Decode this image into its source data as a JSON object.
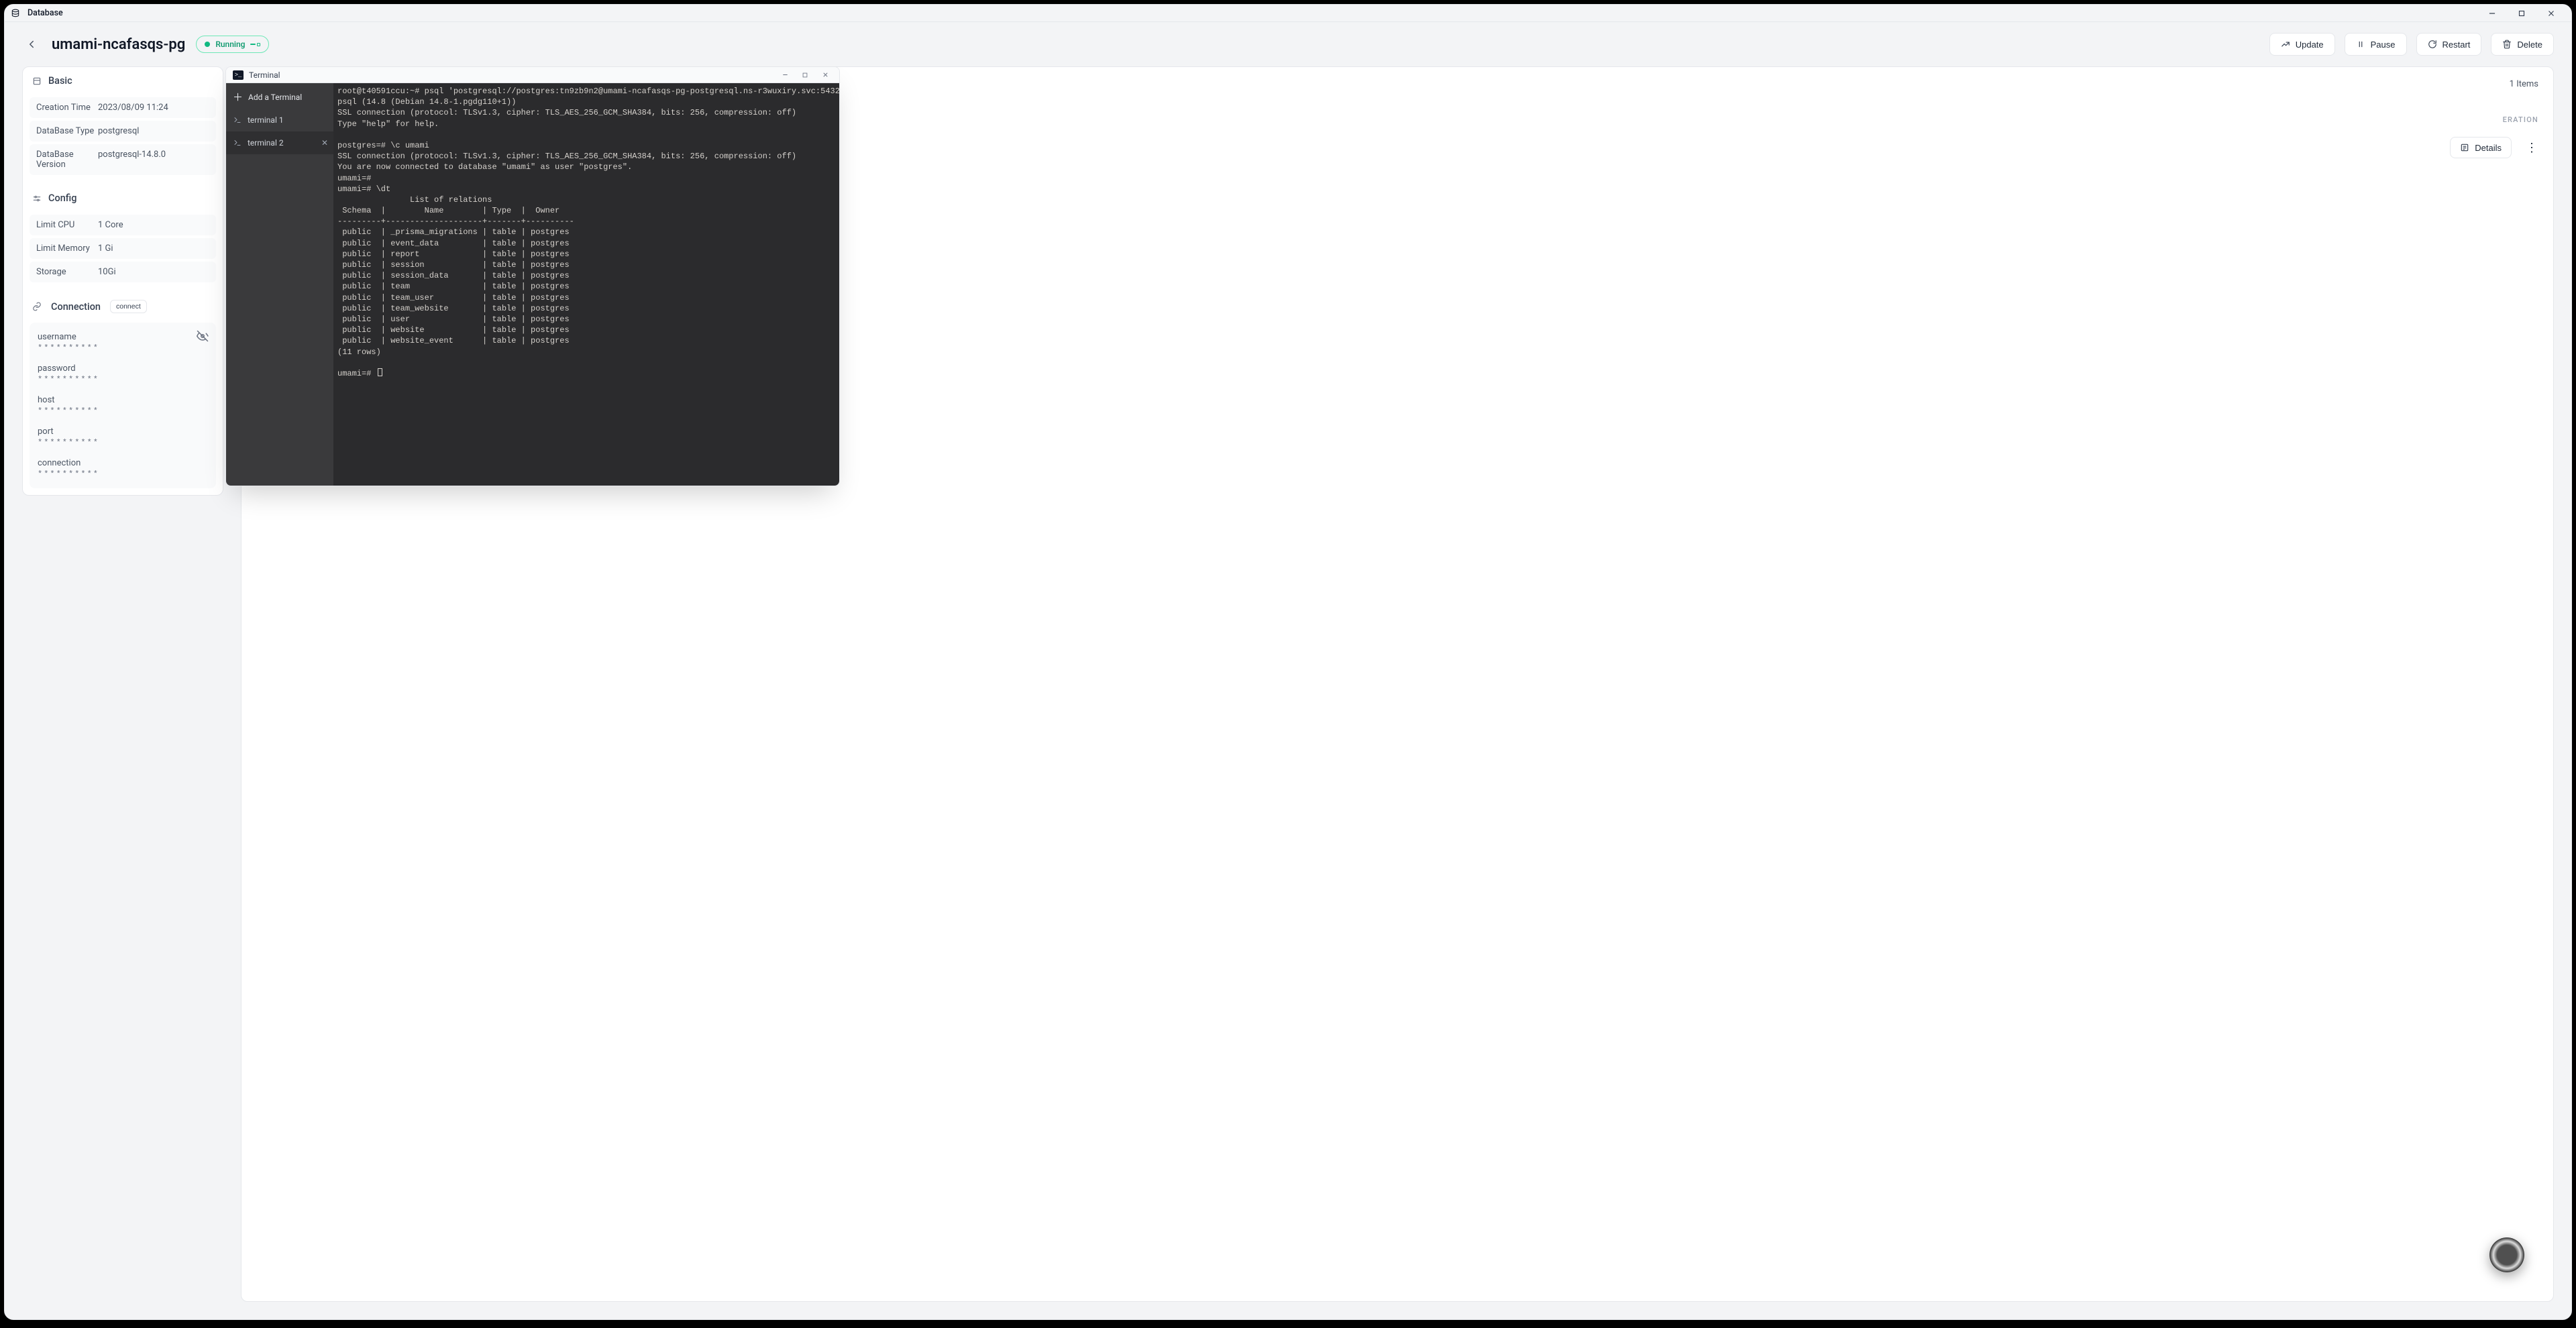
{
  "window": {
    "title": "Database"
  },
  "header": {
    "name": "umami-ncafasqs-pg",
    "status": "Running",
    "buttons": {
      "update": "Update",
      "pause": "Pause",
      "restart": "Restart",
      "delete": "Delete"
    }
  },
  "basic": {
    "title": "Basic",
    "rows": {
      "creation_time": {
        "k": "Creation Time",
        "v": "2023/08/09 11:24"
      },
      "db_type": {
        "k": "DataBase Type",
        "v": "postgresql"
      },
      "db_version": {
        "k": "DataBase Version",
        "v": "postgresql-14.8.0"
      }
    }
  },
  "config": {
    "title": "Config",
    "rows": {
      "cpu": {
        "k": "Limit CPU",
        "v": "1 Core"
      },
      "memory": {
        "k": "Limit Memory",
        "v": "1 Gi"
      },
      "storage": {
        "k": "Storage",
        "v": "10Gi"
      }
    }
  },
  "connection": {
    "title": "Connection",
    "connect_btn": "connect",
    "mask": "**********",
    "items": [
      "username",
      "password",
      "host",
      "port",
      "connection"
    ]
  },
  "content": {
    "items_label": "1 Items",
    "col_operation": "ERATION",
    "details": "Details"
  },
  "terminal": {
    "win_title": "Terminal",
    "add_tab": "Add a Terminal",
    "tabs": [
      "terminal 1",
      "terminal 2"
    ],
    "active_tab": 1,
    "output": "root@t40591ccu:~# psql 'postgresql://postgres:tn9zb9n2@umami-ncafasqs-pg-postgresql.ns-r3wuxiry.svc:5432'\npsql (14.8 (Debian 14.8-1.pgdg110+1))\nSSL connection (protocol: TLSv1.3, cipher: TLS_AES_256_GCM_SHA384, bits: 256, compression: off)\nType \"help\" for help.\n\npostgres=# \\c umami\nSSL connection (protocol: TLSv1.3, cipher: TLS_AES_256_GCM_SHA384, bits: 256, compression: off)\nYou are now connected to database \"umami\" as user \"postgres\".\numami=#\numami=# \\dt\n               List of relations\n Schema  |        Name        | Type  |  Owner\n---------+--------------------+-------+----------\n public  | _prisma_migrations | table | postgres\n public  | event_data         | table | postgres\n public  | report             | table | postgres\n public  | session            | table | postgres\n public  | session_data       | table | postgres\n public  | team               | table | postgres\n public  | team_user          | table | postgres\n public  | team_website       | table | postgres\n public  | user               | table | postgres\n public  | website            | table | postgres\n public  | website_event      | table | postgres\n(11 rows)\n\numami=# "
  }
}
